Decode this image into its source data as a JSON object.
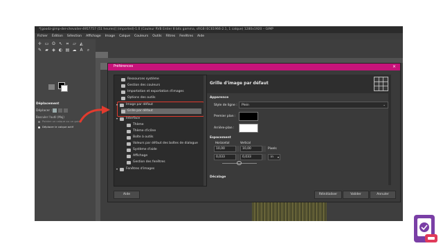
{
  "window": {
    "title": "*[goodz-gimp-der-chevalier-4957757 (51 heures)] (imported)-1.0 (Couleur RVB Entier 8 bits gamma, sRGB IEC61966-2.1, 1 calque) 1280x1920 – GIMP",
    "menu": [
      "Fichier",
      "Édition",
      "Sélection",
      "Affichage",
      "Image",
      "Calque",
      "Couleurs",
      "Outils",
      "Filtres",
      "Fenêtres",
      "Aide"
    ]
  },
  "tool_options": {
    "title": "Déplacement",
    "mode_label": "Déplacer :",
    "toggle_label": "Basculer l'outil (Maj)",
    "option1": "Pointer un calque ou un guide",
    "option2": "Déplacer le calque actif"
  },
  "dialog": {
    "title": "Préférences",
    "close": "×",
    "tree": [
      {
        "label": "Ressources système",
        "indent": 1
      },
      {
        "label": "Gestion des couleurs",
        "indent": 1
      },
      {
        "label": "Importation et exportation d'images",
        "indent": 1
      },
      {
        "label": "Options des outils",
        "indent": 1
      },
      {
        "label": "Image par défaut",
        "indent": 0
      },
      {
        "label": "Grille par défaut",
        "indent": 1
      },
      {
        "label": "Interface",
        "indent": 0
      },
      {
        "label": "Thème",
        "indent": 2
      },
      {
        "label": "Thème d'icône",
        "indent": 2
      },
      {
        "label": "Boîte à outils",
        "indent": 2
      },
      {
        "label": "Valeurs par défaut des boîtes de dialogue",
        "indent": 2
      },
      {
        "label": "Système d'aide",
        "indent": 2
      },
      {
        "label": "Affichage",
        "indent": 2
      },
      {
        "label": "Gestion des fenêtres",
        "indent": 2
      },
      {
        "label": "Fenêtres d'images",
        "indent": 0
      }
    ],
    "page_title": "Grille d'image par défaut",
    "appearance_title": "Apparence",
    "line_style_label": "Style de ligne :",
    "line_style_value": "Plein",
    "foreground_label": "Premier plan :",
    "background_label": "Arrière-plan :",
    "spacing_title": "Espacement",
    "horizontal_label": "Horizontal",
    "vertical_label": "Vertical",
    "spacing_h": "10,00",
    "spacing_v": "10,00",
    "spacing_unit": "Pixels",
    "res_h": "0,033",
    "res_v": "0,033",
    "res_unit": "in",
    "offset_title": "Décalage",
    "buttons": {
      "help": "Aide",
      "reset": "Réinitialiser",
      "ok": "Valider",
      "cancel": "Annuler"
    }
  },
  "colors": {
    "accent": "#c7137a",
    "highlight": "#e23b2e"
  }
}
